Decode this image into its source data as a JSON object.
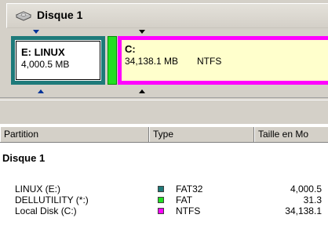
{
  "disk": {
    "title": "Disque 1",
    "icon": "disk-icon"
  },
  "map": {
    "partitions": [
      {
        "name": "E:  LINUX",
        "size": "4,000.5 MB",
        "color": "#1e7a7a"
      },
      {
        "name": "",
        "size": "",
        "color": "#22e022"
      },
      {
        "name": "C:",
        "size": "34,138.1 MB",
        "fs": "NTFS",
        "color": "#ff00ff"
      }
    ]
  },
  "list": {
    "columns": {
      "partition": "Partition",
      "type": "Type",
      "size": "Taille en Mo"
    },
    "group": "Disque 1",
    "rows": [
      {
        "name": "LINUX (E:)",
        "type": "FAT32",
        "size": "4,000.5",
        "color": "#1e7a7a"
      },
      {
        "name": "DELLUTILITY (*:)",
        "type": "FAT",
        "size": "31.3",
        "color": "#22e022"
      },
      {
        "name": "Local Disk (C:)",
        "type": "NTFS",
        "size": "34,138.1",
        "color": "#ff00ff"
      }
    ]
  }
}
